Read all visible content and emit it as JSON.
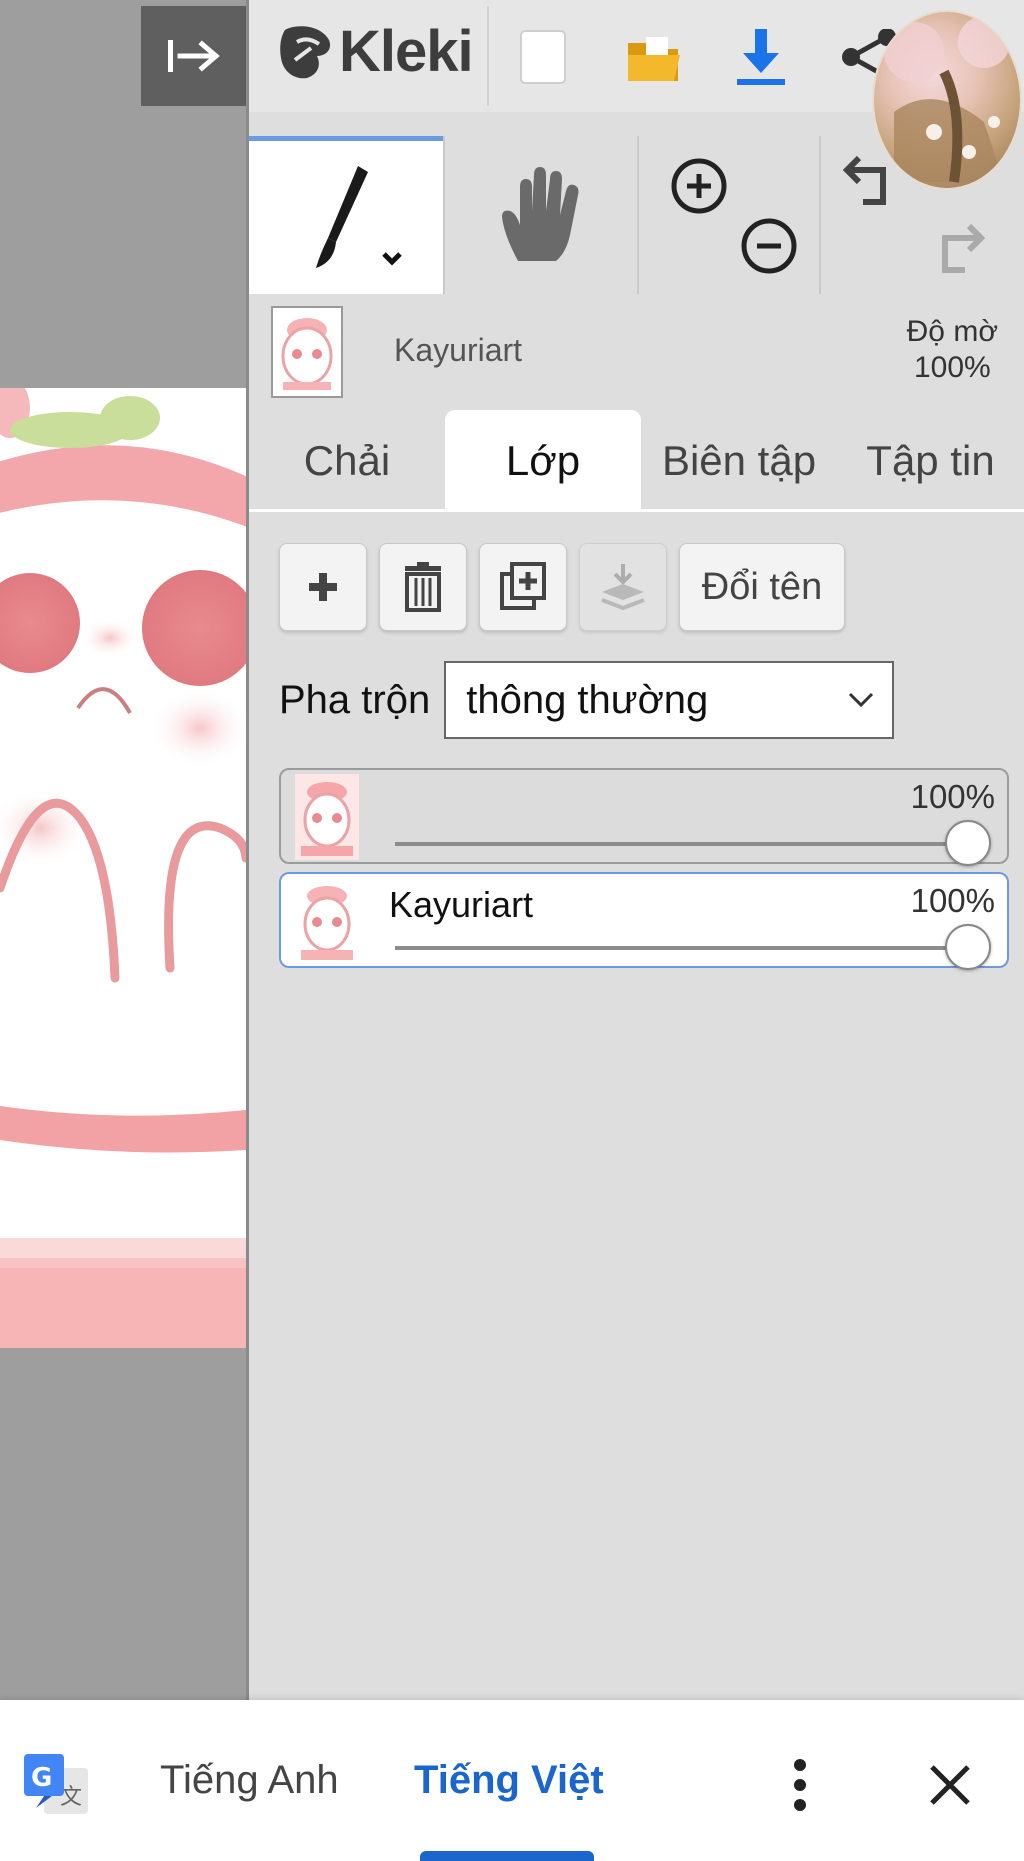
{
  "app": {
    "logo_text": "Kleki"
  },
  "toolbar": {
    "collapse_icon": "collapse-right-icon",
    "new_icon": "new-file-icon",
    "open_icon": "folder-icon",
    "save_icon": "download-icon",
    "share_icon": "share-icon"
  },
  "tools": {
    "brush_icon": "brush-icon",
    "hand_icon": "hand-icon",
    "zoom_in_icon": "zoom-in-icon",
    "zoom_out_icon": "zoom-out-icon",
    "undo_icon": "undo-icon",
    "redo_icon": "redo-icon"
  },
  "current_layer": {
    "name": "Kayuriart",
    "opacity_label": "Độ mờ",
    "opacity_value": "100%"
  },
  "tabs": [
    {
      "label": "Chải",
      "active": false
    },
    {
      "label": "Lớp",
      "active": true
    },
    {
      "label": "Biên tập",
      "active": false
    },
    {
      "label": "Tập tin",
      "active": false
    }
  ],
  "layer_actions": {
    "rename_label": "Đổi tên"
  },
  "blend": {
    "label": "Pha trộn",
    "value": "thông thường"
  },
  "layers": [
    {
      "name": "",
      "opacity": "100%",
      "level": 1.0
    },
    {
      "name": "Kayuriart",
      "opacity": "100%",
      "level": 1.0
    }
  ],
  "translate": {
    "source_lang": "Tiếng Anh",
    "target_lang": "Tiếng Việt"
  },
  "colors": {
    "accent": "#1a66cc",
    "tab_underline": "#6b9ae0",
    "folder": "#f4b82c",
    "download": "#1a73e8"
  }
}
